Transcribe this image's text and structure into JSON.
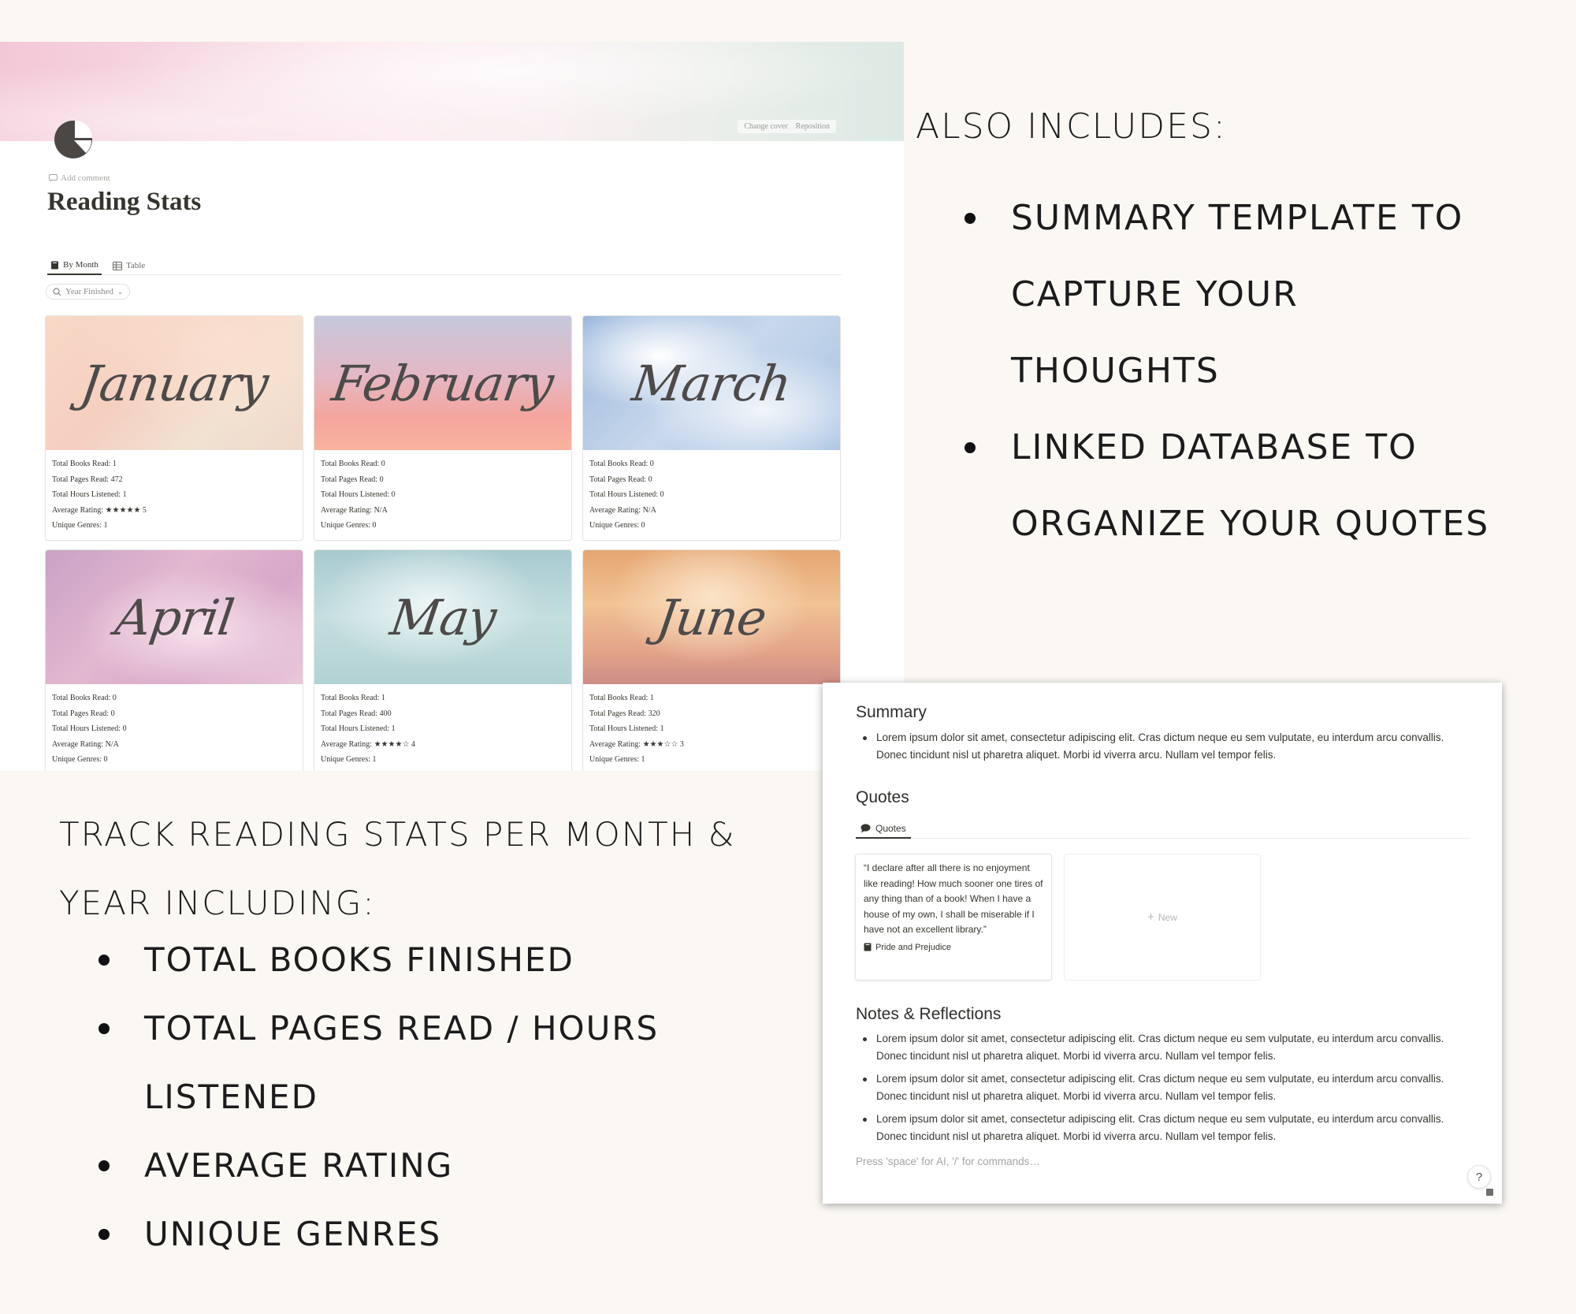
{
  "notion": {
    "cover_buttons": [
      "Change cover",
      "Reposition"
    ],
    "add_comment": "Add comment",
    "title": "Reading Stats",
    "tabs": [
      {
        "label": "By Month",
        "icon": "book-icon"
      },
      {
        "label": "Table",
        "icon": "table-icon"
      }
    ],
    "filter": {
      "label": "Year Finished",
      "icon": "search-icon"
    },
    "stat_labels": {
      "books": "Total Books Read:",
      "pages": "Total Pages Read:",
      "hours": "Total Hours Listened:",
      "rating": "Average Rating:",
      "genres": "Unique Genres:"
    },
    "cards": [
      {
        "month": "January",
        "books": "1",
        "pages": "472",
        "hours": "1",
        "rating": "★★★★★ 5",
        "genres": "1"
      },
      {
        "month": "February",
        "books": "0",
        "pages": "0",
        "hours": "0",
        "rating": "N/A",
        "genres": "0"
      },
      {
        "month": "March",
        "books": "0",
        "pages": "0",
        "hours": "0",
        "rating": "N/A",
        "genres": "0"
      },
      {
        "month": "April",
        "books": "0",
        "pages": "0",
        "hours": "0",
        "rating": "N/A",
        "genres": "0"
      },
      {
        "month": "May",
        "books": "1",
        "pages": "400",
        "hours": "1",
        "rating": "★★★★☆ 4",
        "genres": "1"
      },
      {
        "month": "June",
        "books": "1",
        "pages": "320",
        "hours": "1",
        "rating": "★★★☆☆ 3",
        "genres": "1"
      }
    ]
  },
  "also": {
    "title": "ALSO INCLUDES:",
    "items": [
      [
        "SUMMARY TEMPLATE TO",
        "CAPTURE YOUR",
        "THOUGHTS"
      ],
      [
        "LINKED DATABASE TO",
        "ORGANIZE YOUR  QUOTES"
      ]
    ]
  },
  "track": {
    "title": "TRACK READING STATS PER MONTH & YEAR INCLUDING:",
    "items": [
      [
        "TOTAL BOOKS FINISHED"
      ],
      [
        "TOTAL PAGES READ / HOURS",
        "LISTENED"
      ],
      [
        "AVERAGE RATING"
      ],
      [
        "UNIQUE GENRES"
      ]
    ]
  },
  "template": {
    "summary_heading": "Summary",
    "summary_items": [
      "Lorem ipsum dolor sit amet, consectetur adipiscing elit. Cras dictum neque eu sem vulputate, eu interdum arcu convallis. Donec tincidunt nisl ut pharetra aliquet. Morbi id viverra arcu. Nullam vel tempor felis."
    ],
    "quotes_heading": "Quotes",
    "quotes_tab": "Quotes",
    "quote_card": {
      "text": "“I declare after all there is no enjoyment like reading! How much sooner one tires of any thing than of a book! When I have a house of my own, I shall be miserable if I have not an excellent library.”",
      "book": "Pride and Prejudice"
    },
    "new_label": "New",
    "notes_heading": "Notes & Reflections",
    "notes_items": [
      "Lorem ipsum dolor sit amet, consectetur adipiscing elit. Cras dictum neque eu sem vulputate, eu interdum arcu convallis. Donec tincidunt nisl ut pharetra aliquet. Morbi id viverra arcu. Nullam vel tempor felis.",
      "Lorem ipsum dolor sit amet, consectetur adipiscing elit. Cras dictum neque eu sem vulputate, eu interdum arcu convallis. Donec tincidunt nisl ut pharetra aliquet. Morbi id viverra arcu. Nullam vel tempor felis.",
      "Lorem ipsum dolor sit amet, consectetur adipiscing elit. Cras dictum neque eu sem vulputate, eu interdum arcu convallis. Donec tincidunt nisl ut pharetra aliquet. Morbi id viverra arcu. Nullam vel tempor felis."
    ],
    "placeholder": "Press 'space' for AI, '/' for commands…",
    "help": "?"
  }
}
